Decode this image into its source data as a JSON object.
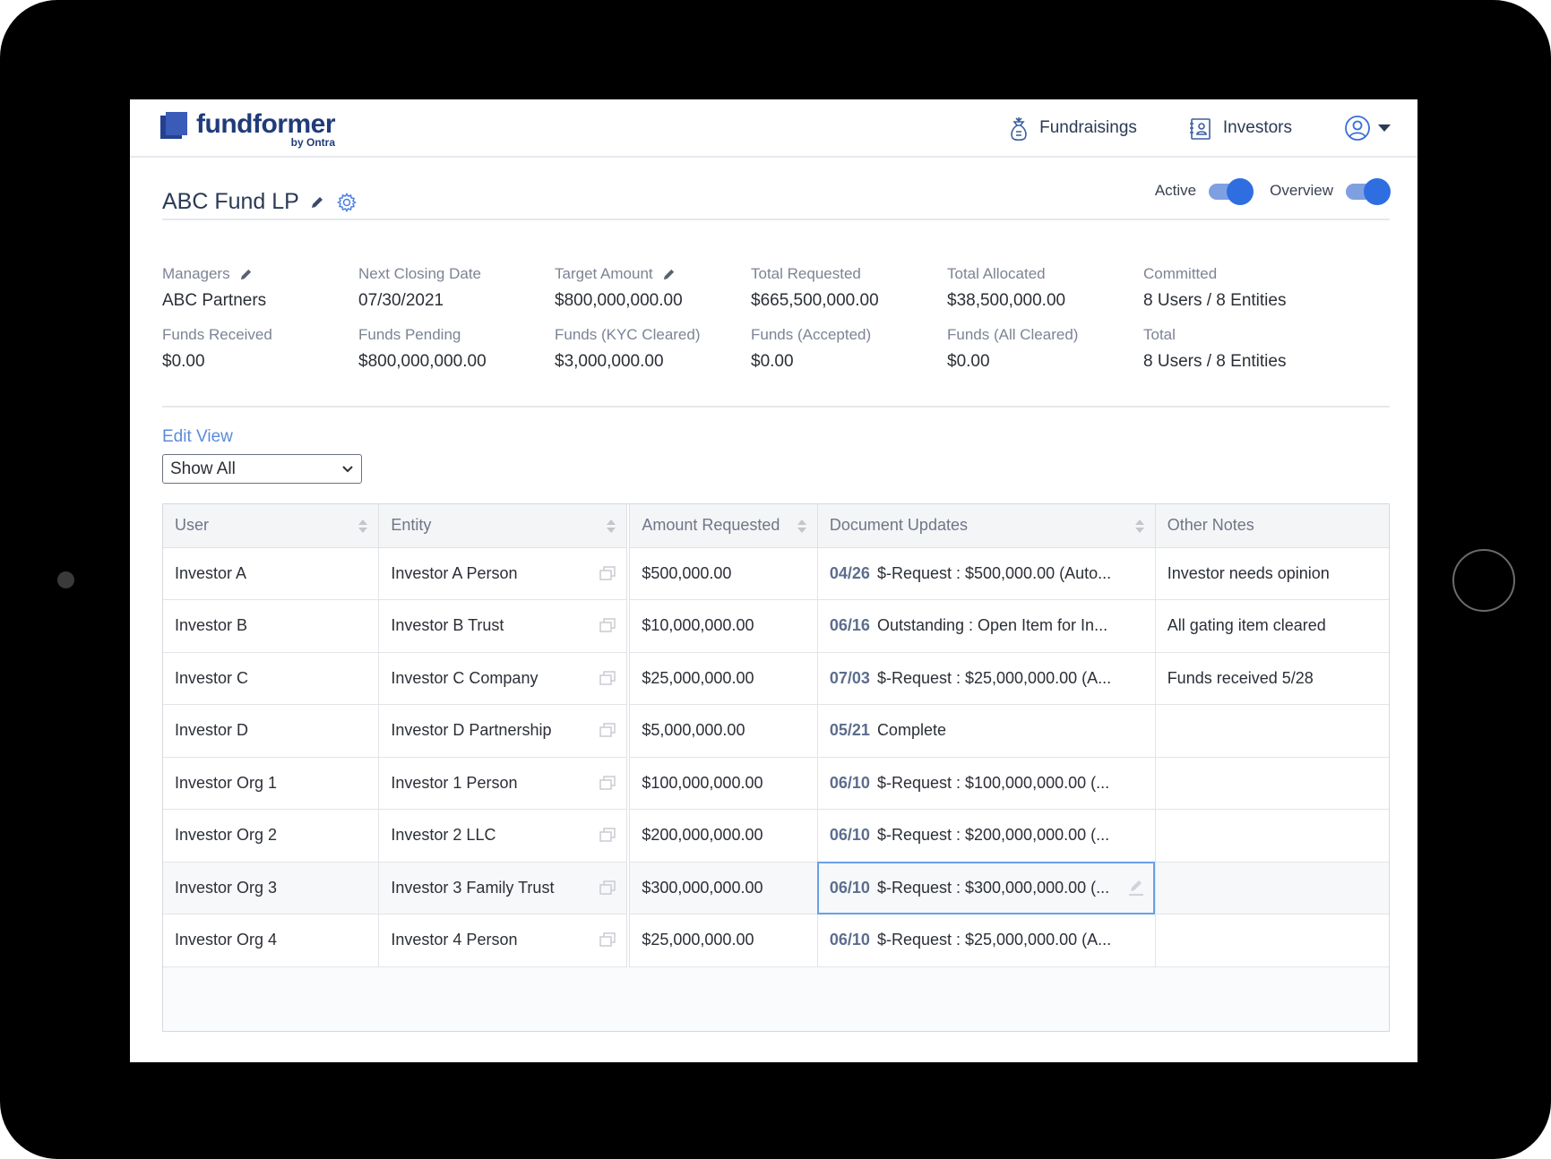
{
  "header": {
    "logo_name": "fundformer",
    "logo_by": "by Ontra",
    "nav": [
      {
        "label": "Fundraisings",
        "icon": "money-bag-icon"
      },
      {
        "label": "Investors",
        "icon": "contact-card-icon"
      }
    ],
    "user_icon": "user-circle-icon"
  },
  "fund": {
    "title": "ABC Fund LP",
    "toggles": [
      {
        "label": "Active",
        "on": true
      },
      {
        "label": "Overview",
        "on": true
      }
    ]
  },
  "stats": [
    {
      "label": "Managers",
      "value": "ABC Partners",
      "editable": true
    },
    {
      "label": "Next Closing Date",
      "value": "07/30/2021"
    },
    {
      "label": "Target Amount",
      "value": "$800,000,000.00",
      "editable": true
    },
    {
      "label": "Total Requested",
      "value": "$665,500,000.00"
    },
    {
      "label": "Total Allocated",
      "value": "$38,500,000.00"
    },
    {
      "label": "Committed",
      "value": "8 Users / 8 Entities"
    },
    {
      "label": "Funds Received",
      "value": "$0.00"
    },
    {
      "label": "Funds Pending",
      "value": "$800,000,000.00"
    },
    {
      "label": "Funds (KYC Cleared)",
      "value": "$3,000,000.00"
    },
    {
      "label": "Funds (Accepted)",
      "value": "$0.00"
    },
    {
      "label": "Funds (All Cleared)",
      "value": "$0.00"
    },
    {
      "label": "Total",
      "value": "8 Users / 8 Entities"
    }
  ],
  "view": {
    "edit_label": "Edit View",
    "selected": "Show All"
  },
  "table": {
    "columns": [
      "User",
      "Entity",
      "Amount Requested",
      "Document Updates",
      "Other Notes"
    ],
    "rows": [
      {
        "user": "Investor A",
        "entity": "Investor A Person",
        "amount": "$500,000.00",
        "doc_date": "04/26",
        "doc_text": "$-Request : $500,000.00 (Auto...",
        "notes": "Investor needs opinion"
      },
      {
        "user": "Investor B",
        "entity": "Investor B Trust",
        "amount": "$10,000,000.00",
        "doc_date": "06/16",
        "doc_text": "Outstanding : Open Item for In...",
        "notes": "All gating item cleared"
      },
      {
        "user": "Investor C",
        "entity": "Investor C Company",
        "amount": "$25,000,000.00",
        "doc_date": "07/03",
        "doc_text": "$-Request : $25,000,000.00 (A...",
        "notes": "Funds received 5/28"
      },
      {
        "user": "Investor D",
        "entity": "Investor D Partnership",
        "amount": "$5,000,000.00",
        "doc_date": "05/21",
        "doc_text": "Complete",
        "notes": ""
      },
      {
        "user": "Investor Org 1",
        "entity": "Investor 1 Person",
        "amount": "$100,000,000.00",
        "doc_date": "06/10",
        "doc_text": "$-Request : $100,000,000.00 (...",
        "notes": ""
      },
      {
        "user": "Investor Org 2",
        "entity": "Investor 2 LLC",
        "amount": "$200,000,000.00",
        "doc_date": "06/10",
        "doc_text": "$-Request : $200,000,000.00 (...",
        "notes": ""
      },
      {
        "user": "Investor Org 3",
        "entity": "Investor 3 Family Trust",
        "amount": "$300,000,000.00",
        "doc_date": "06/10",
        "doc_text": "$-Request : $300,000,000.00 (...",
        "notes": ""
      },
      {
        "user": "Investor Org 4",
        "entity": "Investor 4 Person",
        "amount": "$25,000,000.00",
        "doc_date": "06/10",
        "doc_text": "$-Request : $25,000,000.00 (A...",
        "notes": ""
      }
    ]
  },
  "colors": {
    "accent": "#2f6ee0",
    "brand": "#1f3b7a",
    "link": "#5b8bd8"
  }
}
